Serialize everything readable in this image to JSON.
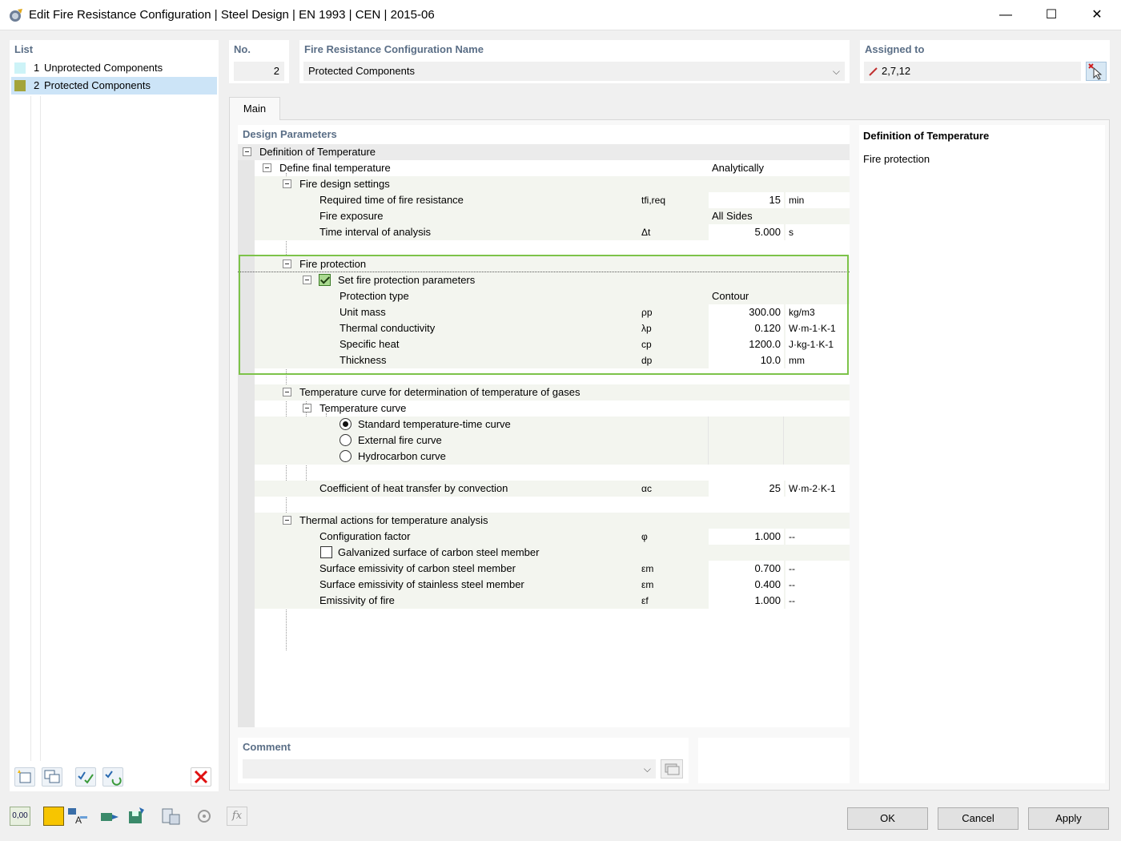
{
  "window": {
    "title": "Edit Fire Resistance Configuration | Steel Design | EN 1993 | CEN | 2015-06",
    "minimize_glyph": "—",
    "maximize_glyph": "☐",
    "close_glyph": "✕"
  },
  "list": {
    "header": "List",
    "items": [
      {
        "num": "1",
        "label": "Unprotected Components",
        "color": "#cdf3f7"
      },
      {
        "num": "2",
        "label": "Protected Components",
        "color": "#a3a43a"
      }
    ],
    "toolbar_icons": [
      "new-item-icon",
      "copy-item-icon",
      "check-all-icon",
      "renumber-icon",
      "delete-icon"
    ]
  },
  "number": {
    "header": "No.",
    "value": "2"
  },
  "name": {
    "header": "Fire Resistance Configuration Name",
    "value": "Protected Components"
  },
  "assigned": {
    "header": "Assigned to",
    "value": "2,7,12"
  },
  "tabs": [
    {
      "label": "Main"
    }
  ],
  "design": {
    "header": "Design Parameters",
    "rows": {
      "def_temp": {
        "label": "Definition of Temperature"
      },
      "final_temp": {
        "label": "Define final temperature",
        "value": "Analytically"
      },
      "fire_design": {
        "label": "Fire design settings"
      },
      "req_time": {
        "label": "Required time of fire resistance",
        "symbol": "tfi,req",
        "value": "15",
        "unit": "min"
      },
      "exposure": {
        "label": "Fire exposure",
        "value": "All Sides"
      },
      "interval": {
        "label": "Time interval of analysis",
        "symbol": "Δt",
        "value": "5.000",
        "unit": "s"
      },
      "fire_prot": {
        "label": "Fire protection"
      },
      "set_prot": {
        "label": "Set fire protection parameters",
        "checked": true
      },
      "prot_type": {
        "label": "Protection type",
        "value": "Contour"
      },
      "unit_mass": {
        "label": "Unit mass",
        "symbol": "ρp",
        "value": "300.00",
        "unit": "kg/m3"
      },
      "conductivity": {
        "label": "Thermal conductivity",
        "symbol": "λp",
        "value": "0.120",
        "unit": "W·m-1·K-1"
      },
      "specific_heat": {
        "label": "Specific heat",
        "symbol": "cp",
        "value": "1200.0",
        "unit": "J·kg-1·K-1"
      },
      "thickness": {
        "label": "Thickness",
        "symbol": "dp",
        "value": "10.0",
        "unit": "mm"
      },
      "temp_curve_gas": {
        "label": "Temperature curve for determination of temperature of gases"
      },
      "temp_curve": {
        "label": "Temperature curve"
      },
      "std_curve": {
        "label": "Standard temperature-time curve",
        "selected": true
      },
      "ext_curve": {
        "label": "External fire curve",
        "selected": false
      },
      "hydro_curve": {
        "label": "Hydrocarbon curve",
        "selected": false
      },
      "convection": {
        "label": "Coefficient of heat transfer by convection",
        "symbol": "αc",
        "value": "25",
        "unit": "W·m-2·K-1"
      },
      "thermal_actions": {
        "label": "Thermal actions for temperature analysis"
      },
      "config_factor": {
        "label": "Configuration factor",
        "symbol": "φ",
        "value": "1.000",
        "unit": "--"
      },
      "galvanized": {
        "label": "Galvanized surface of carbon steel member",
        "checked": false
      },
      "emis_carbon": {
        "label": "Surface emissivity of carbon steel member",
        "symbol": "εm",
        "value": "0.700",
        "unit": "--"
      },
      "emis_stainless": {
        "label": "Surface emissivity of stainless steel member",
        "symbol": "εm",
        "value": "0.400",
        "unit": "--"
      },
      "emis_fire": {
        "label": "Emissivity of fire",
        "symbol": "εf",
        "value": "1.000",
        "unit": "--"
      }
    }
  },
  "info": {
    "title": "Definition of Temperature",
    "text": "Fire protection"
  },
  "comment": {
    "header": "Comment",
    "value": ""
  },
  "footer": {
    "ok": "OK",
    "cancel": "Cancel",
    "apply": "Apply",
    "units_icon_text": "0,00",
    "icons": [
      "units-icon",
      "color-icon",
      "text-style-icon",
      "view-icon",
      "save-icon",
      "library-icon",
      "reset-icon",
      "formula-icon"
    ]
  }
}
